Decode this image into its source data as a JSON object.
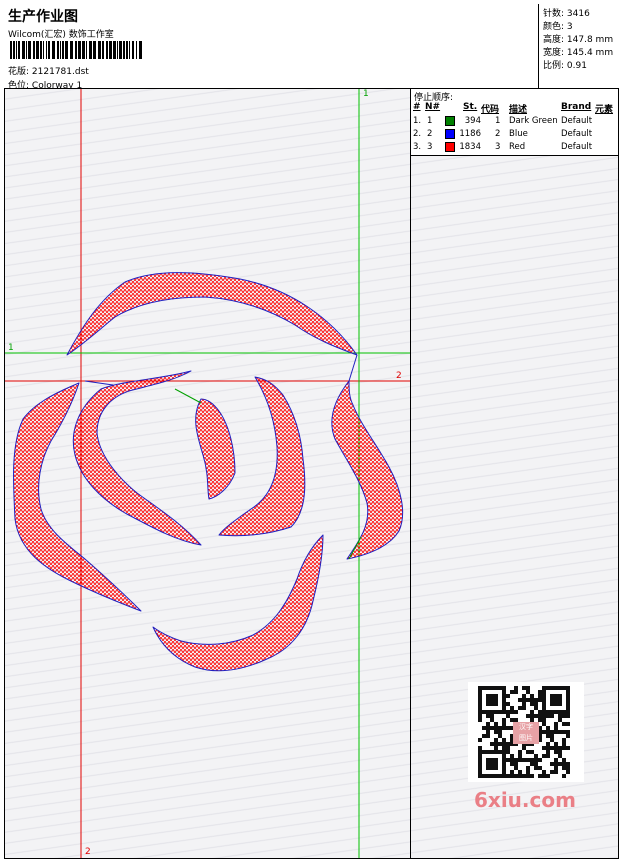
{
  "header": {
    "title": "生产作业图",
    "subtitle": "Wilcom(汇宏) 数饰工作室",
    "design_label": "花版:",
    "design_value": "2121781.dst",
    "colorway_label": "色位:",
    "colorway_value": "Colorway 1"
  },
  "stats": [
    {
      "label": "针数:",
      "value": "3416"
    },
    {
      "label": "颜色:",
      "value": "3"
    },
    {
      "label": "高度:",
      "value": "147.8 mm"
    },
    {
      "label": "宽度:",
      "value": "145.4 mm"
    },
    {
      "label": "比例:",
      "value": "0.91"
    }
  ],
  "stop_sequence": {
    "title": "停止顺序:",
    "columns": [
      "#",
      "N#",
      "St.",
      "代码",
      "描述",
      "Brand",
      "元素"
    ],
    "rows": [
      {
        "no": "1.",
        "n": "1",
        "color": "#008000",
        "stitches": "394",
        "code": "1",
        "description": "Dark Green",
        "brand": "Default"
      },
      {
        "no": "2.",
        "n": "2",
        "color": "#0000ff",
        "stitches": "1186",
        "code": "2",
        "description": "Blue",
        "brand": "Default"
      },
      {
        "no": "3.",
        "n": "3",
        "color": "#ff0000",
        "stitches": "1834",
        "code": "3",
        "description": "Red",
        "brand": "Default"
      }
    ]
  },
  "guides": {
    "green_v_label": "1",
    "green_h_label": "1",
    "red_h_label": "2",
    "red_v_label": "2"
  },
  "watermark": {
    "text": "6xiu.com",
    "stamp_line1": "汉字",
    "stamp_line2": "图片"
  },
  "colors": {
    "guide_red": "#e00000",
    "guide_green": "#00c000",
    "stitch_red": "#ff0000",
    "stitch_blue": "#2020c0"
  }
}
